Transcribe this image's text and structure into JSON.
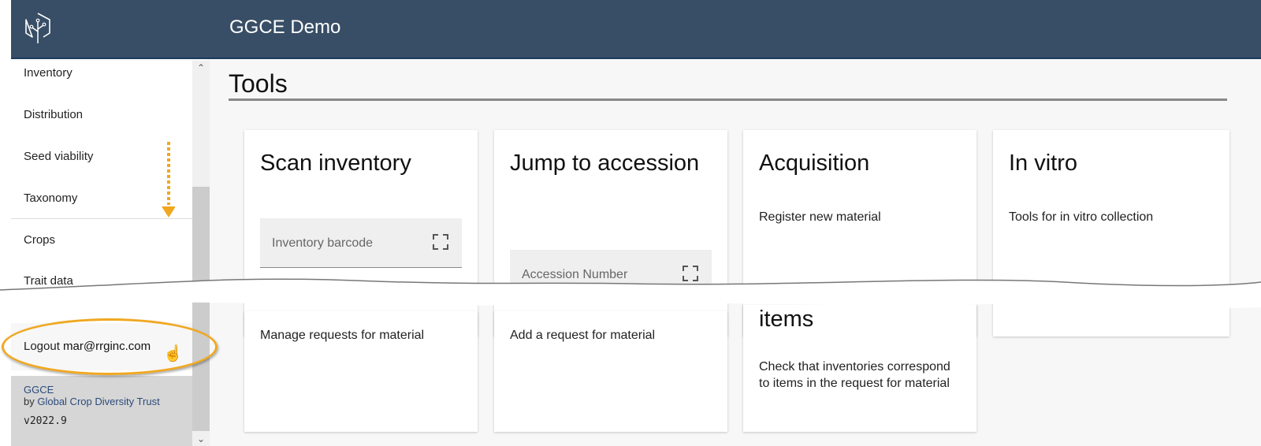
{
  "header": {
    "logo_icon": "tree-hexagon-logo-icon",
    "title": "GGCE Demo",
    "color": "#384e66"
  },
  "sidebar": {
    "items": [
      {
        "label": "Inventory"
      },
      {
        "label": "Distribution"
      },
      {
        "label": "Seed viability"
      },
      {
        "label": "Taxonomy"
      },
      {
        "label": "Crops"
      },
      {
        "label": "Trait data"
      }
    ],
    "logout_label": "Logout",
    "user_email": "mar@rrginc.com",
    "footer": {
      "brand": "GGCE",
      "by_text": "by",
      "org": "Global Crop Diversity Trust",
      "version": "v2022.9"
    },
    "scroll_up_icon": "chevron-up-icon",
    "scroll_down_icon": "chevron-down-icon"
  },
  "annotation": {
    "highlight_color": "#f0a820"
  },
  "main": {
    "page_title": "Tools",
    "cards_top": [
      {
        "title": "Scan inventory",
        "field_placeholder": "Inventory barcode",
        "field_icon": "scan-icon"
      },
      {
        "title": "Jump to accession",
        "field_placeholder": "Accession Number",
        "field_icon": "scan-icon"
      },
      {
        "title": "Acquisition",
        "description": "Register new material"
      },
      {
        "title": "In vitro",
        "description": "Tools for in vitro collection"
      }
    ],
    "cards_bottom": [
      {
        "description": "Manage requests for material"
      },
      {
        "description": "Add a request for material"
      },
      {
        "title_fragment": "items",
        "description": "Check that inventories correspond to items in the request for material"
      }
    ]
  }
}
